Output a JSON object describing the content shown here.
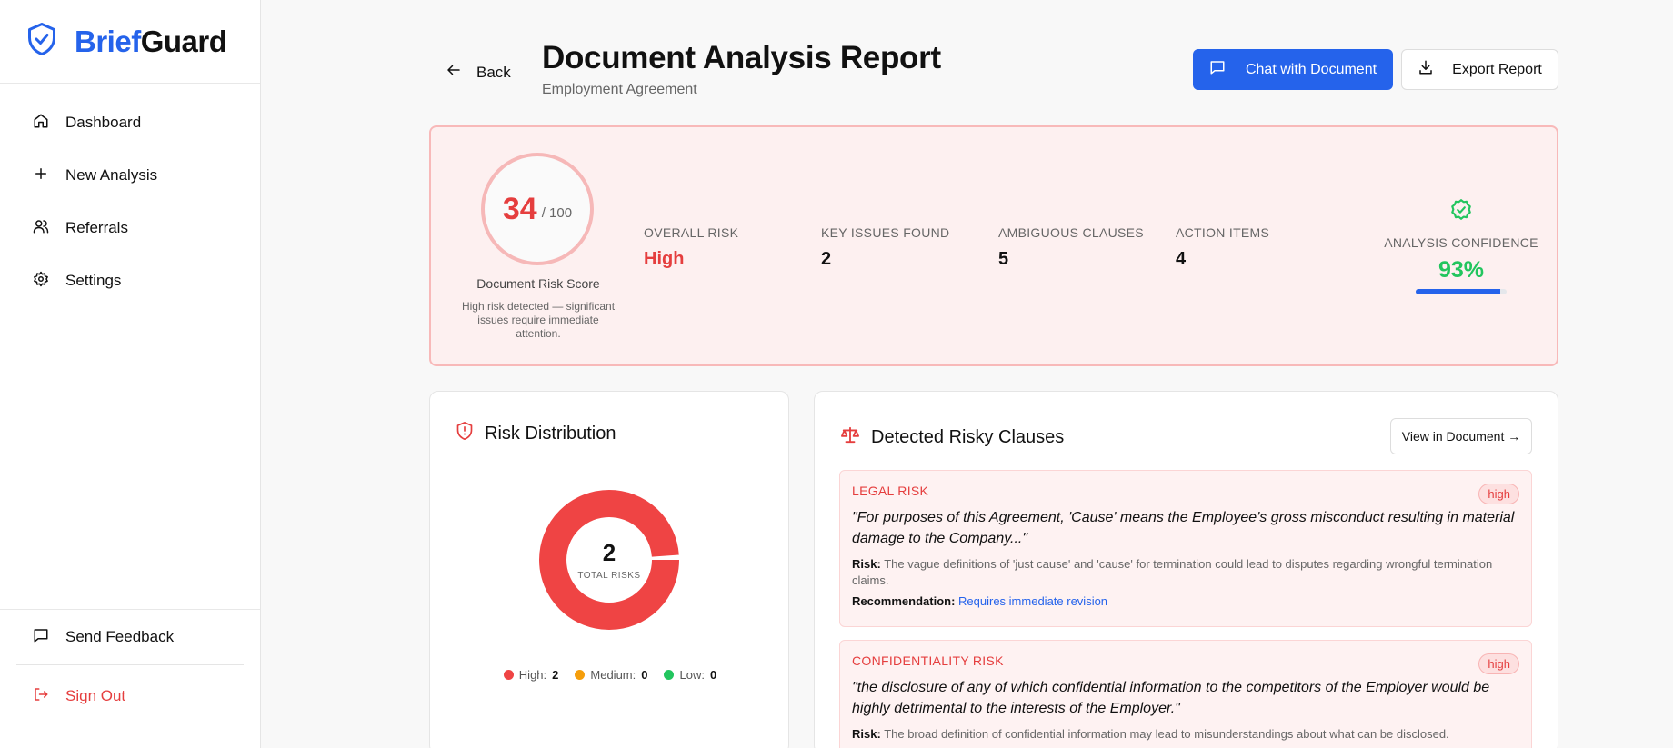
{
  "brand": {
    "name_part1": "Brief",
    "name_part2": "Guard"
  },
  "sidebar": {
    "items": [
      {
        "label": "Dashboard",
        "icon": "home-icon"
      },
      {
        "label": "New Analysis",
        "icon": "plus-icon"
      },
      {
        "label": "Referrals",
        "icon": "users-icon"
      },
      {
        "label": "Settings",
        "icon": "gear-icon"
      }
    ],
    "feedback_label": "Send Feedback",
    "signout_label": "Sign Out"
  },
  "header": {
    "back_label": "Back",
    "title": "Document Analysis Report",
    "subtitle": "Employment Agreement",
    "chat_label": "Chat with Document",
    "export_label": "Export Report"
  },
  "summary": {
    "score": "34",
    "score_max": "/ 100",
    "score_label": "Document Risk Score",
    "score_note": "High risk detected — significant issues require immediate attention.",
    "stats": [
      {
        "label": "OVERALL RISK",
        "value": "High"
      },
      {
        "label": "KEY ISSUES FOUND",
        "value": "2"
      },
      {
        "label": "AMBIGUOUS CLAUSES",
        "value": "5"
      },
      {
        "label": "ACTION ITEMS",
        "value": "4"
      }
    ],
    "confidence_label": "ANALYSIS CONFIDENCE",
    "confidence_value": "93%",
    "confidence_fraction": 0.93,
    "risk_color": "#e53e3e",
    "confidence_color": "#22c55e"
  },
  "distribution": {
    "title": "Risk Distribution",
    "total": "2",
    "total_label": "TOTAL RISKS",
    "legend": [
      {
        "label": "High:",
        "value": "2",
        "color": "#ef4444"
      },
      {
        "label": "Medium:",
        "value": "0",
        "color": "#f59e0b"
      },
      {
        "label": "Low:",
        "value": "0",
        "color": "#22c55e"
      }
    ]
  },
  "clauses": {
    "title": "Detected Risky Clauses",
    "view_label": "View in Document →",
    "items": [
      {
        "type": "LEGAL RISK",
        "severity": "high",
        "quote": "\"For purposes of this Agreement, 'Cause' means the Employee's gross misconduct resulting in material damage to the Company...\"",
        "risk_label": "Risk:",
        "risk": "The vague definitions of 'just cause' and 'cause' for termination could lead to disputes regarding wrongful termination claims.",
        "rec_label": "Recommendation:",
        "rec": "Requires immediate revision"
      },
      {
        "type": "CONFIDENTIALITY RISK",
        "severity": "high",
        "quote": "\"the disclosure of any of which confidential information to the competitors of the Employer would be highly detrimental to the interests of the Employer.\"",
        "risk_label": "Risk:",
        "risk": "The broad definition of confidential information may lead to misunderstandings about what can be disclosed."
      }
    ]
  }
}
